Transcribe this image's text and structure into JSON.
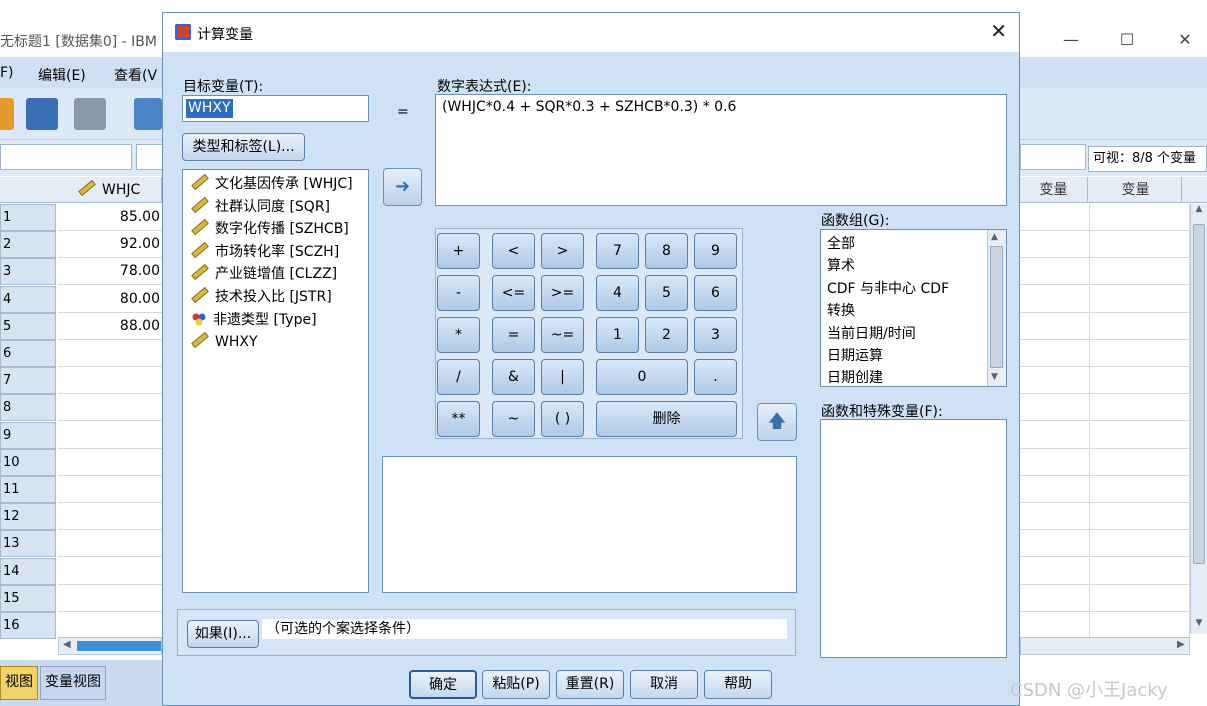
{
  "background_window": {
    "title": "无标题1 [数据集0] - IBM",
    "menu": [
      "F)",
      "编辑(E)",
      "查看(V"
    ],
    "visible_counter": "可视：8/8 个变量",
    "column_header": "WHJC",
    "right_col_headers": [
      "变量",
      "变量"
    ],
    "rows": [
      {
        "n": "1",
        "v": "85.00"
      },
      {
        "n": "2",
        "v": "92.00"
      },
      {
        "n": "3",
        "v": "78.00"
      },
      {
        "n": "4",
        "v": "80.00"
      },
      {
        "n": "5",
        "v": "88.00"
      },
      {
        "n": "6",
        "v": ""
      },
      {
        "n": "7",
        "v": ""
      },
      {
        "n": "8",
        "v": ""
      },
      {
        "n": "9",
        "v": ""
      },
      {
        "n": "10",
        "v": ""
      },
      {
        "n": "11",
        "v": ""
      },
      {
        "n": "12",
        "v": ""
      },
      {
        "n": "13",
        "v": ""
      },
      {
        "n": "14",
        "v": ""
      },
      {
        "n": "15",
        "v": ""
      },
      {
        "n": "16",
        "v": ""
      }
    ],
    "tabs": [
      "视图",
      "变量视图"
    ],
    "window_controls": [
      "—",
      "☐",
      "✕"
    ]
  },
  "dialog": {
    "title": "计算变量",
    "target_label": "目标变量(T):",
    "target_value": "WHXY",
    "equals": "=",
    "type_label_button": "类型和标签(L)...",
    "expr_label": "数字表达式(E):",
    "expression": "(WHJC*0.4 + SQR*0.3 + SZHCB*0.3) * 0.6",
    "variables": [
      {
        "name": "文化基因传承 [WHJC]",
        "icon": "scale-ruler"
      },
      {
        "name": "社群认同度 [SQR]",
        "icon": "scale-ruler"
      },
      {
        "name": "数字化传播 [SZHCB]",
        "icon": "scale-ruler"
      },
      {
        "name": "市场转化率 [SCZH]",
        "icon": "scale-ruler"
      },
      {
        "name": "产业链增值 [CLZZ]",
        "icon": "scale-ruler"
      },
      {
        "name": "技术投入比 [JSTR]",
        "icon": "scale-ruler"
      },
      {
        "name": "非遗类型 [Type]",
        "icon": "nominal"
      },
      {
        "name": "WHXY",
        "icon": "scale-ruler"
      }
    ],
    "keypad": {
      "row1": [
        "+",
        "<",
        ">",
        "7",
        "8",
        "9"
      ],
      "row2": [
        "-",
        "<=",
        ">=",
        "4",
        "5",
        "6"
      ],
      "row3": [
        "*",
        "=",
        "~=",
        "1",
        "2",
        "3"
      ],
      "row4": [
        "/",
        "&",
        "|",
        "0",
        "."
      ],
      "row5": [
        "**",
        "~",
        "( )",
        "删除"
      ]
    },
    "func_group_label": "函数组(G):",
    "func_groups": [
      "全部",
      "算术",
      "CDF 与非中心 CDF",
      "转换",
      "当前日期/时间",
      "日期运算",
      "日期创建"
    ],
    "func_special_label": "函数和特殊变量(F):",
    "if_button": "如果(I)...",
    "if_text": "（可选的个案选择条件）",
    "footer_buttons": [
      "确定",
      "粘贴(P)",
      "重置(R)",
      "取消",
      "帮助"
    ]
  },
  "watermark": "CSDN @小王Jacky"
}
